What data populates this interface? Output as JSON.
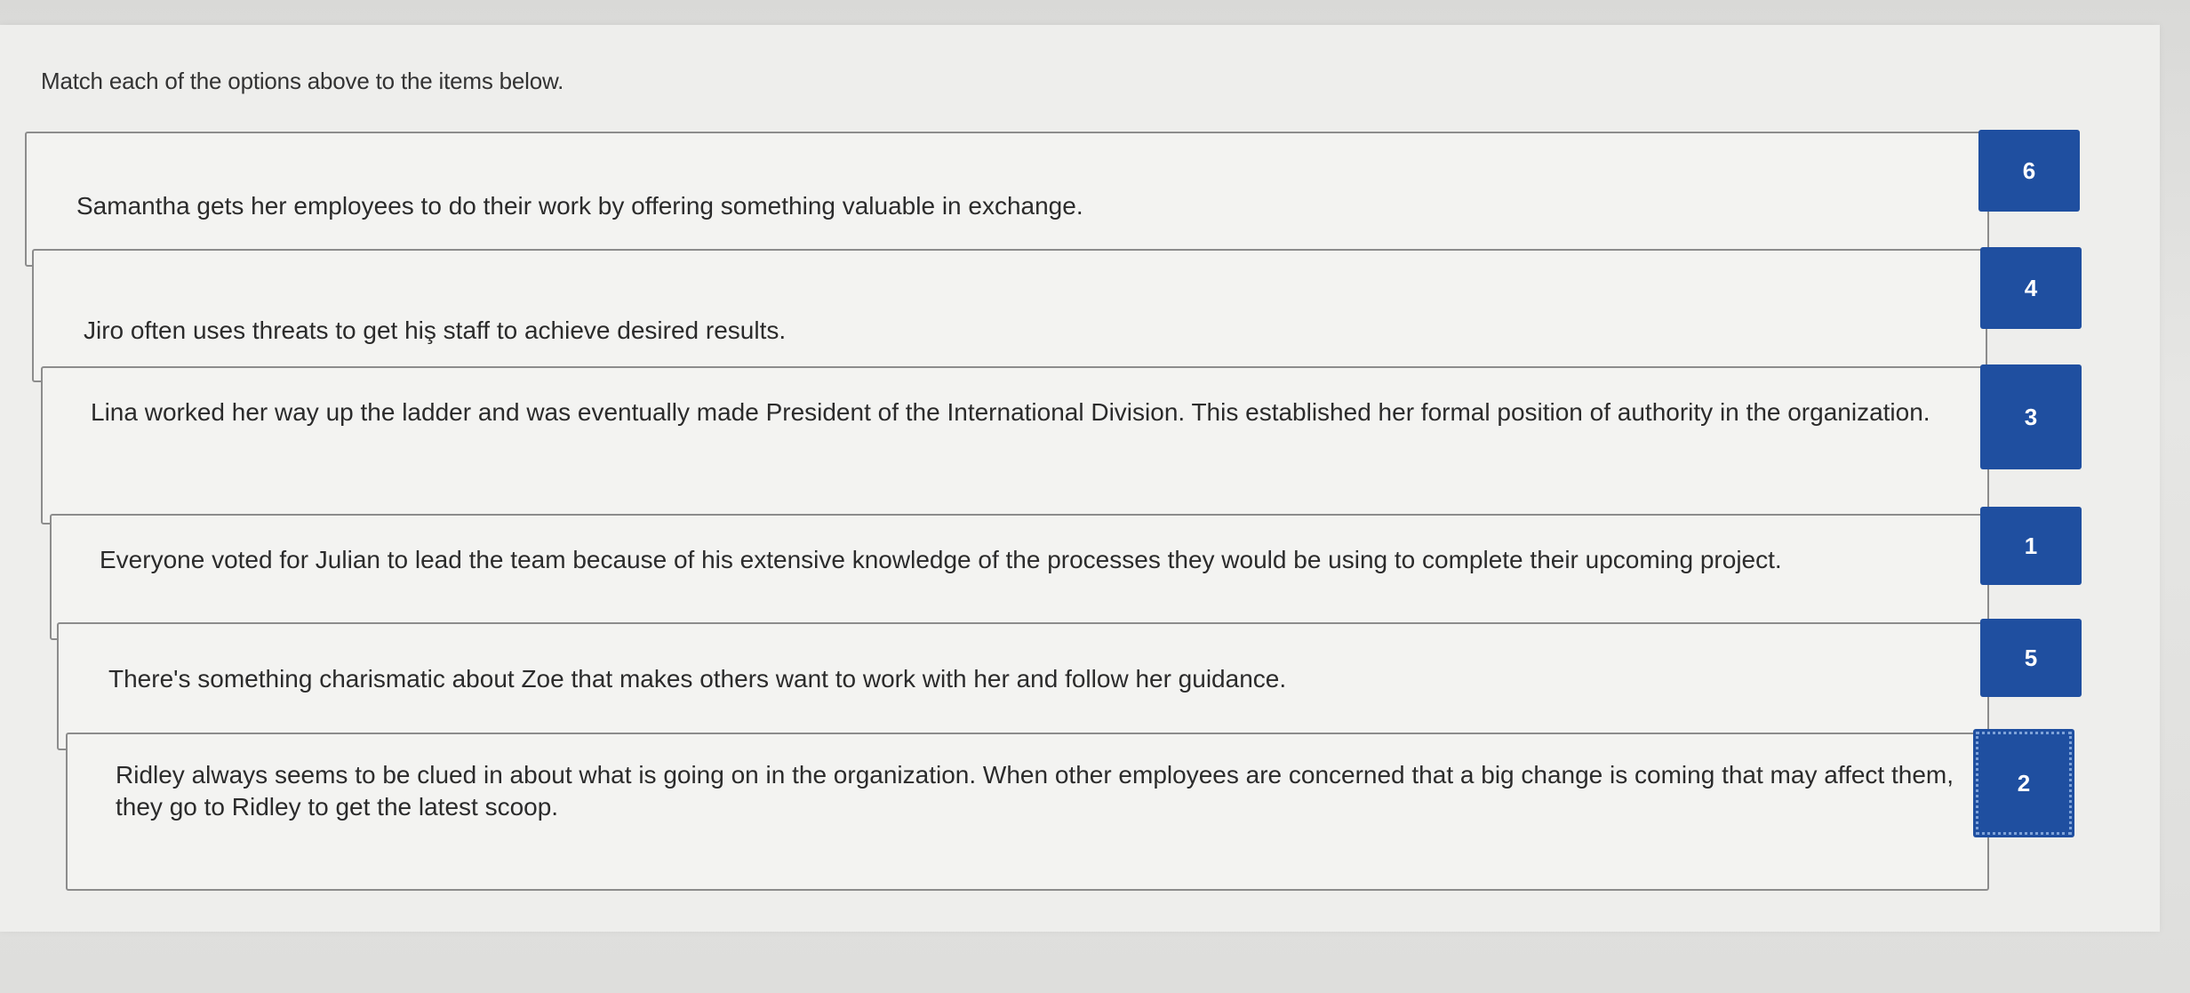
{
  "instruction": "Match each of the options above to the items below.",
  "items": [
    {
      "text": "Samantha gets her employees to do their work by offering something valuable in exchange.",
      "answer": "6"
    },
    {
      "text": "Jiro often uses threats to get hiş staff to achieve desired results.",
      "answer": "4"
    },
    {
      "text": "Lina worked her way up the ladder and was eventually made President of the International Division. This established her formal position of authority in the organization.",
      "answer": "3"
    },
    {
      "text": "Everyone voted for Julian to lead the team because of his extensive knowledge of the processes they would be using to complete their upcoming project.",
      "answer": "1"
    },
    {
      "text": "There's something charismatic about Zoe that makes others want to work with her and follow her guidance.",
      "answer": "5"
    },
    {
      "text": "Ridley always seems to be clued in about what is going on in the organization. When other employees are concerned that a big change is coming that may affect them, they go to Ridley to get the latest scoop.",
      "answer": "2"
    }
  ],
  "colors": {
    "answer_box": "#1f4fa0",
    "card_border": "#8c8c8c"
  }
}
